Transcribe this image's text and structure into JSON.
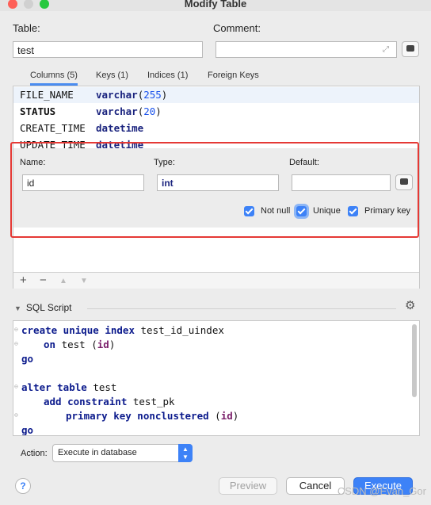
{
  "window": {
    "title": "Modify Table"
  },
  "form": {
    "table_label": "Table:",
    "table_value": "test",
    "comment_label": "Comment:",
    "comment_value": ""
  },
  "tabs": [
    "Columns (5)",
    "Keys (1)",
    "Indices (1)",
    "Foreign Keys"
  ],
  "columns": [
    {
      "name": "FILE_NAME",
      "type": "varchar",
      "size": "255"
    },
    {
      "name": "STATUS",
      "type": "varchar",
      "size": "20"
    },
    {
      "name": "CREATE_TIME",
      "type": "datetime",
      "size": ""
    },
    {
      "name": "UPDATE_TIME",
      "type": "datetime",
      "size": ""
    }
  ],
  "editor": {
    "name_label": "Name:",
    "name_value": "id",
    "type_label": "Type:",
    "type_value": "int",
    "default_label": "Default:",
    "default_value": "",
    "not_null_label": "Not null",
    "not_null": true,
    "unique_label": "Unique",
    "unique": true,
    "primary_key_label": "Primary key",
    "primary_key": true
  },
  "toolbar": {
    "add": "+",
    "remove": "−",
    "up": "▲",
    "down": "▼"
  },
  "sql": {
    "header": "SQL Script",
    "line1_kw": "create unique index",
    "line1_rest": " test_id_uindex",
    "line2_kw": "on",
    "line2_rest": " test (",
    "line2_id": "id",
    "line2_end": ")",
    "line3": "go",
    "line5_kw": "alter table",
    "line5_rest": " test",
    "line6_kw": "add constraint",
    "line6_rest": " test_pk",
    "line7_kw": "primary key nonclustered",
    "line7_rest": " (",
    "line7_id": "id",
    "line7_end": ")",
    "line8": "go"
  },
  "action": {
    "label": "Action:",
    "value": "Execute in database"
  },
  "buttons": {
    "help": "?",
    "preview": "Preview",
    "cancel": "Cancel",
    "execute": "Execute"
  },
  "watermark": "CSDN @Evan_Gor",
  "colors": {
    "accent": "#3d82f7",
    "highlight_box": "#e53935"
  }
}
